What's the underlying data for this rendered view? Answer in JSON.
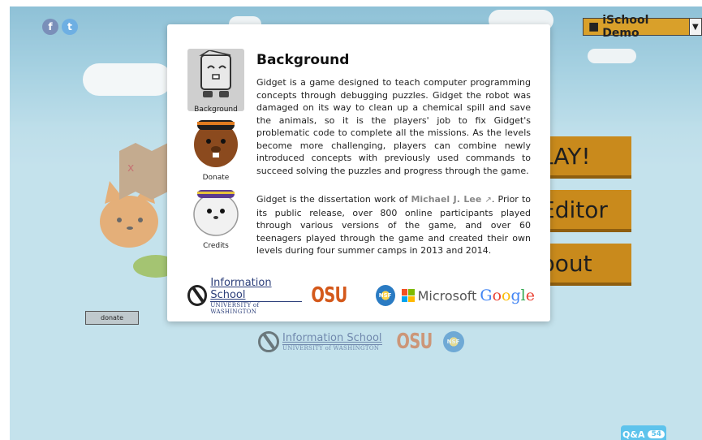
{
  "social": {
    "facebook": "f",
    "twitter": "t"
  },
  "user_menu": {
    "label": "iSchool Demo",
    "icon": "user-icon"
  },
  "menu_buttons": {
    "play": "LAY!",
    "editor": "Editor",
    "about": "bout"
  },
  "donate_button": "donate",
  "qa": {
    "label": "Q&A",
    "count": "54"
  },
  "modal": {
    "sidebar": [
      {
        "label": "Background",
        "icon": "gidget-robot-icon",
        "selected": true
      },
      {
        "label": "Donate",
        "icon": "beaver-icon",
        "selected": false
      },
      {
        "label": "Credits",
        "icon": "seal-icon",
        "selected": false
      }
    ],
    "title": "Background",
    "paragraph1": "Gidget is a game designed to teach computer programming concepts through debugging puzzles. Gidget the robot was damaged on its way to clean up a chemical spill and save the animals, so it is the players' job to fix Gidget's problematic code to complete all the missions. As the levels become more challenging, players can combine newly introduced concepts with previously used commands to succeed solving the puzzles and progress through the game.",
    "paragraph2_pre": "Gidget is the dissertation work of ",
    "author": "Michael J. Lee",
    "external_icon": "external-link-icon",
    "paragraph2_post": ". Prior to its public release, over 800 online participants played through various versions of the game, and over 60 teenagers played through the game and created their own levels during four summer camps in 2013 and 2014.",
    "logos": {
      "ischool_line1": "Information School",
      "ischool_line2": "UNIVERSITY of WASHINGTON",
      "osu": "OSU",
      "nsf": "NSF",
      "microsoft": "Microsoft",
      "google": [
        "G",
        "o",
        "o",
        "g",
        "l",
        "e"
      ]
    }
  },
  "bottom_logos": {
    "ischool_line1": "Information School",
    "ischool_line2": "UNIVERSITY of WASHINGTON",
    "osu": "OSU",
    "nsf": "NSF"
  },
  "colors": {
    "sky": "#82bfd6",
    "button": "#c98a1c",
    "accent_blue": "#5ec3ec"
  }
}
